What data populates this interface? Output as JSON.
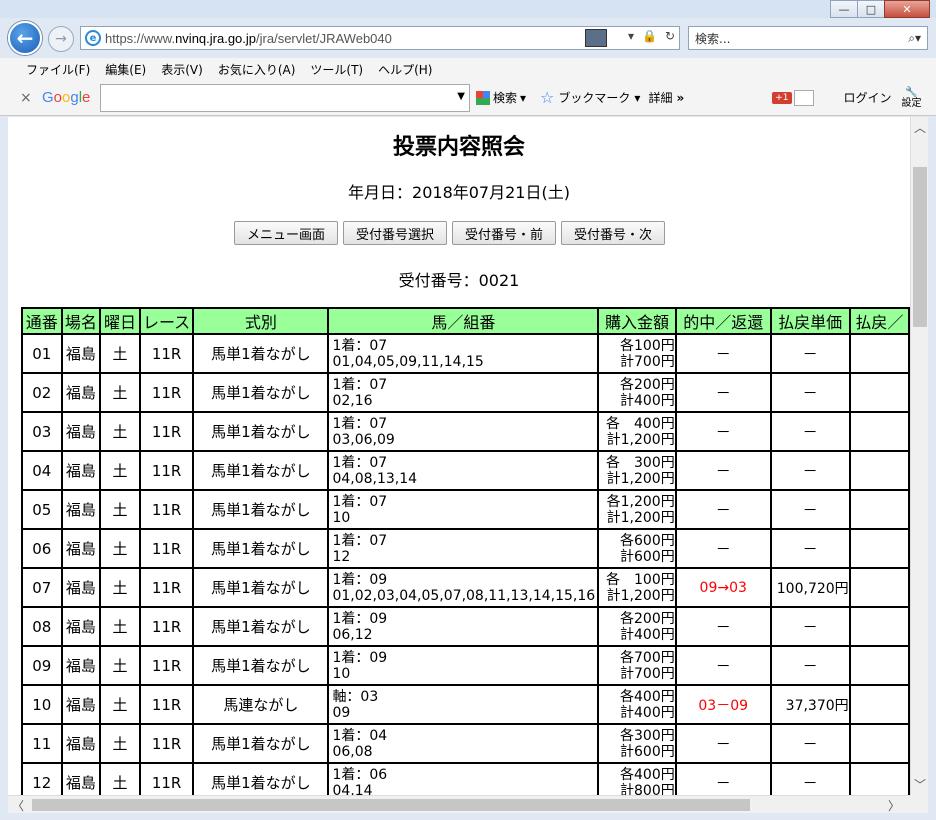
{
  "browser": {
    "url_prefix": "https://www.",
    "url_domain": "nvinq.jra.go.jp",
    "url_path": "/jra/servlet/JRAWeb040",
    "search_placeholder": "検索...",
    "window_buttons": {
      "minimize": "—",
      "maximize": "□",
      "close": "✕"
    },
    "addr_tools": [
      "▾",
      "🔒",
      "↻"
    ],
    "search_icon": "magnifier-icon"
  },
  "menubar": [
    "ファイル(F)",
    "編集(E)",
    "表示(V)",
    "お気に入り(A)",
    "ツール(T)",
    "ヘルプ(H)"
  ],
  "google_toolbar": {
    "close": "×",
    "search_label": "検索",
    "bookmarks_label": "ブックマーク",
    "details_label": "詳細",
    "more": "»",
    "gplus": "+1",
    "login_label": "ログイン",
    "settings_label": "設定"
  },
  "page": {
    "title": "投票内容照会",
    "date_label": "年月日：2018年07月21日(土)",
    "buttons": [
      "メニュー画面",
      "受付番号選択",
      "受付番号・前",
      "受付番号・次"
    ],
    "receipt_label": "受付番号：0021"
  },
  "table": {
    "headers": [
      "通番",
      "場名",
      "曜日",
      "レース",
      "式別",
      "馬／組番",
      "購入金額",
      "的中／返還",
      "払戻単価",
      "払戻／"
    ],
    "rows": [
      {
        "no": "01",
        "place": "福島",
        "day": "土",
        "race": "11R",
        "type": "馬単1着ながし",
        "kumi1": "1着：07",
        "kumi2": "01,04,05,09,11,14,15",
        "amt1": "各100円",
        "amt2": "計700円",
        "hit": "－",
        "pay": "－",
        "red": false
      },
      {
        "no": "02",
        "place": "福島",
        "day": "土",
        "race": "11R",
        "type": "馬単1着ながし",
        "kumi1": "1着：07",
        "kumi2": "02,16",
        "amt1": "各200円",
        "amt2": "計400円",
        "hit": "－",
        "pay": "－",
        "red": false
      },
      {
        "no": "03",
        "place": "福島",
        "day": "土",
        "race": "11R",
        "type": "馬単1着ながし",
        "kumi1": "1着：07",
        "kumi2": "03,06,09",
        "amt1": "各　400円",
        "amt2": "計1,200円",
        "hit": "－",
        "pay": "－",
        "red": false
      },
      {
        "no": "04",
        "place": "福島",
        "day": "土",
        "race": "11R",
        "type": "馬単1着ながし",
        "kumi1": "1着：07",
        "kumi2": "04,08,13,14",
        "amt1": "各　300円",
        "amt2": "計1,200円",
        "hit": "－",
        "pay": "－",
        "red": false
      },
      {
        "no": "05",
        "place": "福島",
        "day": "土",
        "race": "11R",
        "type": "馬単1着ながし",
        "kumi1": "1着：07",
        "kumi2": "10",
        "amt1": "各1,200円",
        "amt2": "計1,200円",
        "hit": "－",
        "pay": "－",
        "red": false
      },
      {
        "no": "06",
        "place": "福島",
        "day": "土",
        "race": "11R",
        "type": "馬単1着ながし",
        "kumi1": "1着：07",
        "kumi2": "12",
        "amt1": "各600円",
        "amt2": "計600円",
        "hit": "－",
        "pay": "－",
        "red": false
      },
      {
        "no": "07",
        "place": "福島",
        "day": "土",
        "race": "11R",
        "type": "馬単1着ながし",
        "kumi1": "1着：09",
        "kumi2": "01,02,03,04,05,07,08,11,13,14,15,16",
        "amt1": "各　100円",
        "amt2": "計1,200円",
        "hit": "09→03",
        "pay": "100,720円",
        "red": true
      },
      {
        "no": "08",
        "place": "福島",
        "day": "土",
        "race": "11R",
        "type": "馬単1着ながし",
        "kumi1": "1着：09",
        "kumi2": "06,12",
        "amt1": "各200円",
        "amt2": "計400円",
        "hit": "－",
        "pay": "－",
        "red": false
      },
      {
        "no": "09",
        "place": "福島",
        "day": "土",
        "race": "11R",
        "type": "馬単1着ながし",
        "kumi1": "1着：09",
        "kumi2": "10",
        "amt1": "各700円",
        "amt2": "計700円",
        "hit": "－",
        "pay": "－",
        "red": false
      },
      {
        "no": "10",
        "place": "福島",
        "day": "土",
        "race": "11R",
        "type": "馬連ながし",
        "kumi1": "軸：03",
        "kumi2": "09",
        "amt1": "各400円",
        "amt2": "計400円",
        "hit": "03－09",
        "pay": "37,370円",
        "red": true
      },
      {
        "no": "11",
        "place": "福島",
        "day": "土",
        "race": "11R",
        "type": "馬単1着ながし",
        "kumi1": "1着：04",
        "kumi2": "06,08",
        "amt1": "各300円",
        "amt2": "計600円",
        "hit": "－",
        "pay": "－",
        "red": false
      },
      {
        "no": "12",
        "place": "福島",
        "day": "土",
        "race": "11R",
        "type": "馬単1着ながし",
        "kumi1": "1着：06",
        "kumi2": "04,14",
        "amt1": "各400円",
        "amt2": "計800円",
        "hit": "－",
        "pay": "－",
        "red": false
      }
    ]
  }
}
